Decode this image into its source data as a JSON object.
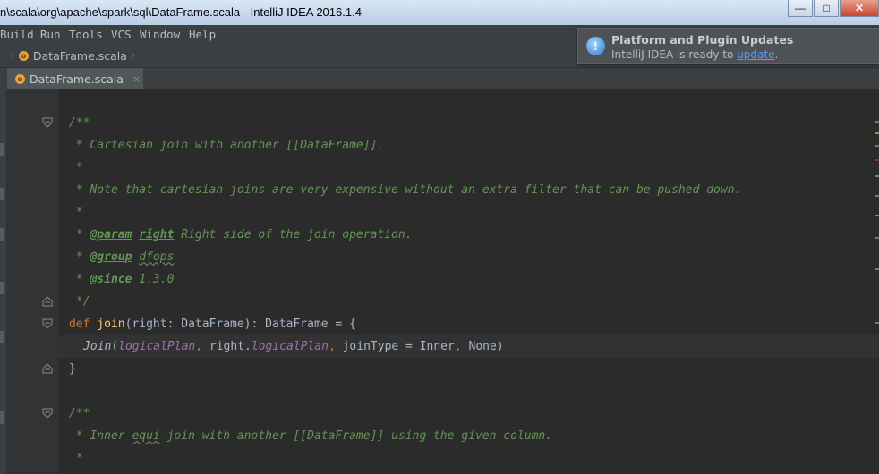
{
  "window": {
    "title": "n\\scala\\org\\apache\\spark\\sql\\DataFrame.scala - IntelliJ IDEA 2016.1.4",
    "minimize": "—",
    "maximize": "□",
    "close": "✕"
  },
  "menu": [
    "Build",
    "Run",
    "Tools",
    "VCS",
    "Window",
    "Help"
  ],
  "breadcrumb": {
    "file": "DataFrame.scala",
    "icon": "scala-file-icon"
  },
  "tab": {
    "label": "DataFrame.scala",
    "close": "×"
  },
  "notification": {
    "title": "Platform and Plugin Updates",
    "text_prefix": "IntelliJ IDEA is ready to ",
    "link": "update",
    "text_suffix": ".",
    "icon": "info-icon"
  },
  "code": {
    "l1": "/**",
    "l2": " * Cartesian join with another [[DataFrame]].",
    "l3": " *",
    "l4": " * Note that cartesian joins are very expensive without an extra filter that can be pushed down.",
    "l5": " *",
    "l6_star": " * ",
    "l6_tag": "@param",
    "l6_name": "right",
    "l6_rest": " Right side of the join operation.",
    "l7_star": " * ",
    "l7_tag": "@group",
    "l7_rest": "dfops",
    "l8_star": " * ",
    "l8_tag": "@since",
    "l8_rest": " 1.3.0",
    "l9": " */",
    "l10_kw": "def",
    "l10_fn": "join",
    "l10_sig": "(right: DataFrame): DataFrame = {",
    "l11_join": "Join",
    "l11_open": "(",
    "l11_f1": "logicalPlan",
    "l11_c1": ",",
    "l11_mid": " right.",
    "l11_f2": "logicalPlan",
    "l11_c2": ",",
    "l11_jt": " joinType = Inner",
    "l11_c3": ",",
    "l11_end": " None)",
    "l12": "}",
    "l13": "/**",
    "l14_a": " * Inner ",
    "l14_b": "equi",
    "l14_c": "-join with another [[DataFrame]] using the given column.",
    "l15": " *"
  },
  "colors": {
    "comment": "#629755",
    "keyword": "#cc7832",
    "function": "#ffc66d",
    "field": "#9876aa",
    "text": "#a9b7c6",
    "background": "#2b2b2b"
  }
}
